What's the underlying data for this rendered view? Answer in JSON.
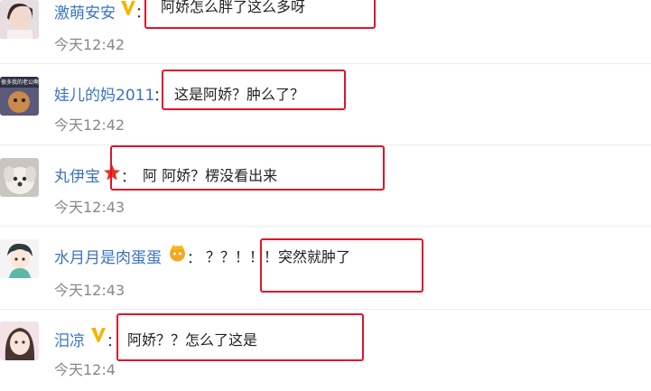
{
  "comments": [
    {
      "username": "激萌安安",
      "text": "阿娇怎么胖了这么多呀",
      "time": "今天12:42",
      "badge": "vip-v-badge-icon"
    },
    {
      "username": "娃儿的妈2011",
      "text": "这是阿娇？肿么了？",
      "time": "今天12:42",
      "badge": ""
    },
    {
      "username": "丸伊宝",
      "text": "阿 阿娇？楞没看出来",
      "time": "今天12:43",
      "badge": "star-badge-icon"
    },
    {
      "username": "水月月是肉蛋蛋",
      "text": "？？！！！突然就肿了",
      "time": "今天12:43",
      "badge": "crown-badge-icon"
    },
    {
      "username": "汨凉",
      "text": "阿娇？？怎么了这是",
      "time": "今天12:4",
      "badge": "vip-v-badge-icon"
    }
  ],
  "avatar_labels": {
    "c1": "很多我的老公啊"
  },
  "colon": "：",
  "colors": {
    "username": "#3a72c4",
    "highlight_border": "#e0142a",
    "time": "#888888"
  }
}
